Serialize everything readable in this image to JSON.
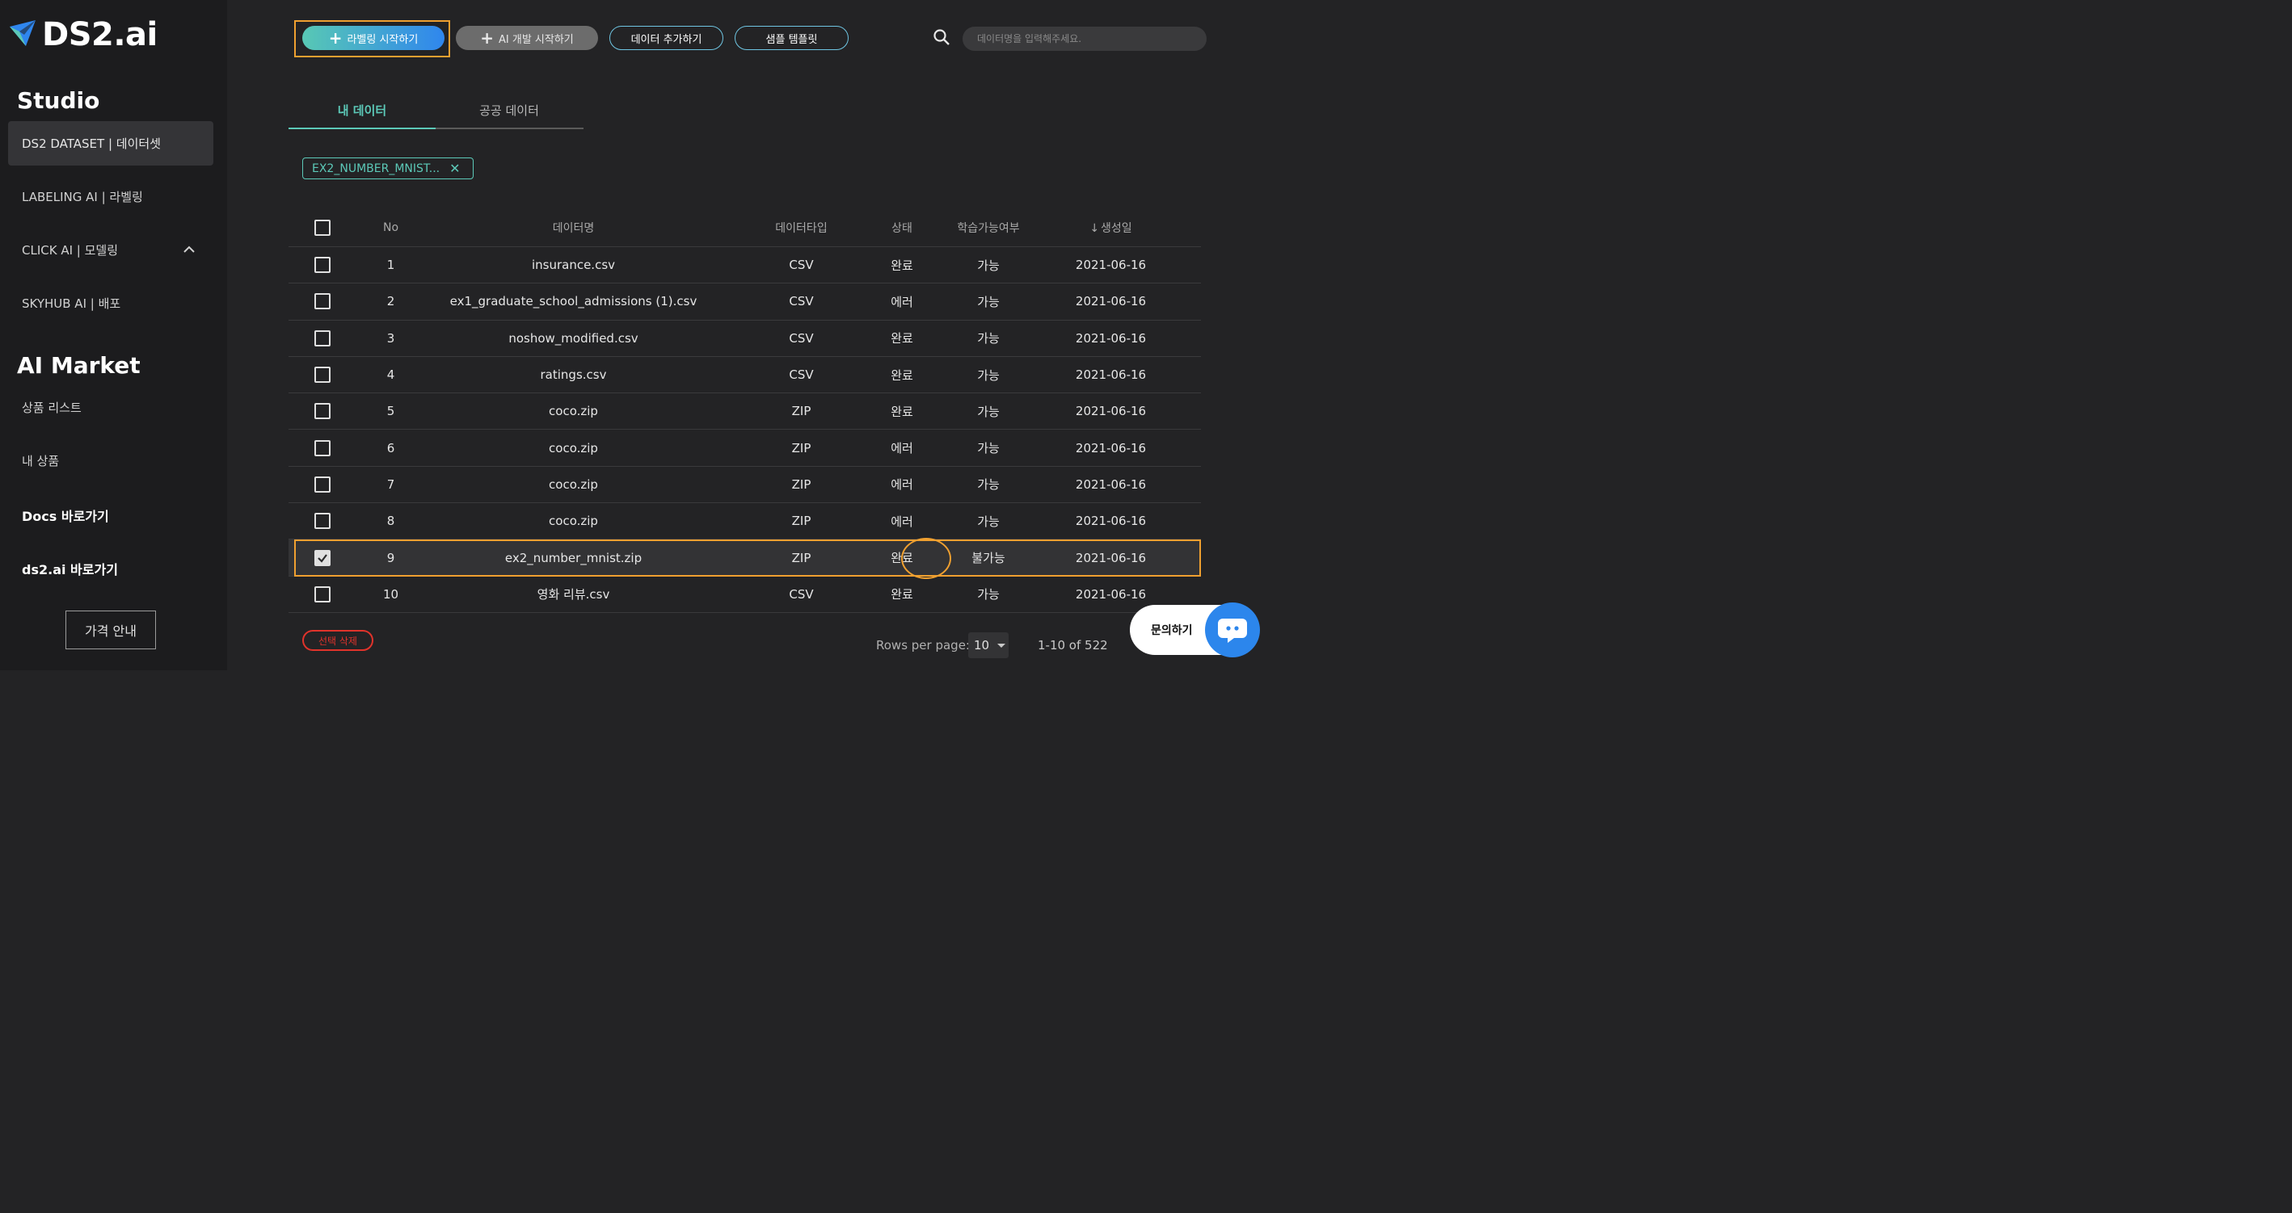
{
  "brand": {
    "name": "DS2.ai",
    "accent": "#2f86ee",
    "teal": "#5cc9b8"
  },
  "sidebar": {
    "studio_title": "Studio",
    "studio_items": [
      {
        "label": "DS2 DATASET | 데이터셋",
        "active": true
      },
      {
        "label": "LABELING AI | 라벨링"
      },
      {
        "label": "CLICK AI | 모델링",
        "icon": "chevron-up-icon"
      },
      {
        "label": "SKYHUB AI | 배포"
      }
    ],
    "market_title": "AI Market",
    "market_items": [
      {
        "label": "상품 리스트"
      },
      {
        "label": "내 상품"
      }
    ],
    "links": [
      {
        "label": "Docs 바로가기"
      },
      {
        "label": "ds2.ai 바로가기"
      }
    ],
    "price_button": "가격 안내"
  },
  "toolbar": {
    "start_labeling": "라벨링 시작하기",
    "start_ai_dev": "AI 개발 시작하기",
    "add_data": "데이터 추가하기",
    "sample_template": "샘플 템플릿",
    "search_placeholder": "데이터명을 입력해주세요."
  },
  "tabs": [
    {
      "label": "내 데이터",
      "active": true
    },
    {
      "label": "공공 데이터"
    }
  ],
  "filter_chip": "EX2_NUMBER_MNIST...",
  "table": {
    "headers": {
      "no": "No",
      "name": "데이터명",
      "type": "데이터타입",
      "status": "상태",
      "trainable": "학습가능여부",
      "date": "생성일"
    },
    "rows": [
      {
        "no": "1",
        "name": "insurance.csv",
        "type": "CSV",
        "status": "완료",
        "trainable": "가능",
        "date": "2021-06-16"
      },
      {
        "no": "2",
        "name": "ex1_graduate_school_admissions (1).csv",
        "type": "CSV",
        "status": "에러",
        "trainable": "가능",
        "date": "2021-06-16"
      },
      {
        "no": "3",
        "name": "noshow_modified.csv",
        "type": "CSV",
        "status": "완료",
        "trainable": "가능",
        "date": "2021-06-16"
      },
      {
        "no": "4",
        "name": "ratings.csv",
        "type": "CSV",
        "status": "완료",
        "trainable": "가능",
        "date": "2021-06-16"
      },
      {
        "no": "5",
        "name": "coco.zip",
        "type": "ZIP",
        "status": "완료",
        "trainable": "가능",
        "date": "2021-06-16"
      },
      {
        "no": "6",
        "name": "coco.zip",
        "type": "ZIP",
        "status": "에러",
        "trainable": "가능",
        "date": "2021-06-16"
      },
      {
        "no": "7",
        "name": "coco.zip",
        "type": "ZIP",
        "status": "에러",
        "trainable": "가능",
        "date": "2021-06-16"
      },
      {
        "no": "8",
        "name": "coco.zip",
        "type": "ZIP",
        "status": "에러",
        "trainable": "가능",
        "date": "2021-06-16"
      },
      {
        "no": "9",
        "name": "ex2_number_mnist.zip",
        "type": "ZIP",
        "status": "완료",
        "trainable": "불가능",
        "date": "2021-06-16",
        "selected": true
      },
      {
        "no": "10",
        "name": "영화 리뷰.csv",
        "type": "CSV",
        "status": "완료",
        "trainable": "가능",
        "date": "2021-06-16"
      }
    ]
  },
  "footer": {
    "delete_selected": "선택 삭제",
    "rows_per_page_label": "Rows per page:",
    "rows_per_page_value": "10",
    "range": "1-10 of 522",
    "inquiry": "문의하기"
  }
}
